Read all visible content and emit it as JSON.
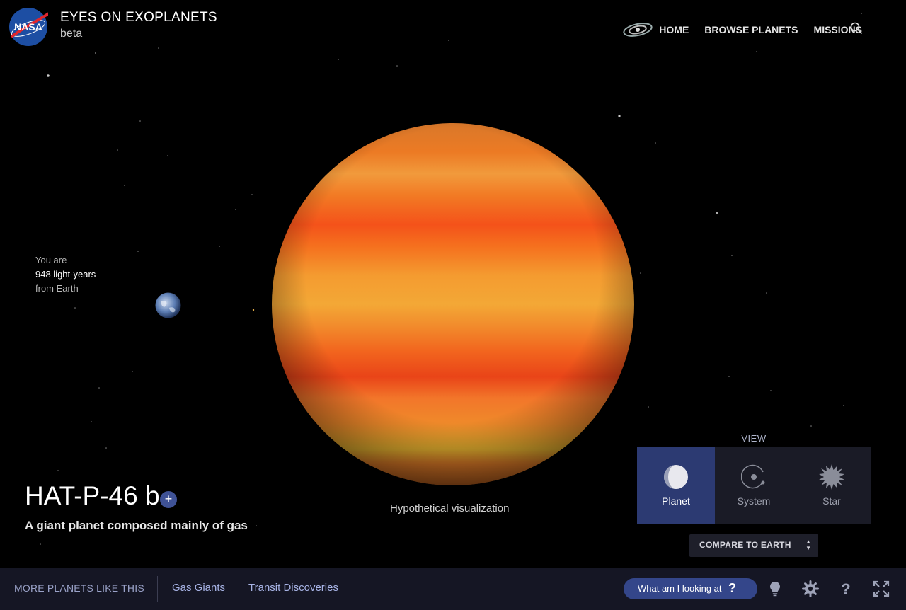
{
  "header": {
    "title": "EYES ON EXOPLANETS",
    "subtitle": "beta",
    "logo": "nasa-logo",
    "nav": [
      {
        "label": "HOME",
        "icon": "galaxy-icon"
      },
      {
        "label": "BROWSE PLANETS"
      },
      {
        "label": "MISSIONS"
      }
    ],
    "search_icon": "search-icon"
  },
  "distance": {
    "line1": "You are",
    "line2": "948 light-years",
    "line3": "from Earth"
  },
  "planet": {
    "name": "HAT-P-46 b",
    "plus_label": "+",
    "description": "A giant planet composed mainly of gas",
    "caption": "Hypothetical visualization"
  },
  "view": {
    "label": "VIEW",
    "options": [
      {
        "label": "Planet",
        "icon": "planet-icon",
        "active": true
      },
      {
        "label": "System",
        "icon": "system-icon",
        "active": false
      },
      {
        "label": "Star",
        "icon": "star-icon",
        "active": false
      }
    ],
    "compare_label": "COMPARE TO EARTH",
    "compare_arrows_up": "▲",
    "compare_arrows_down": "▼"
  },
  "footer": {
    "more_label": "MORE PLANETS LIKE THIS",
    "links": [
      "Gas Giants",
      "Transit Discoveries"
    ],
    "what_label": "What am I looking at",
    "what_q": "?",
    "icons": [
      "lightbulb-icon",
      "settings-icon",
      "help-icon",
      "fullscreen-icon"
    ]
  },
  "colors": {
    "accent": "#34468a",
    "active_view": "#2c3a72",
    "footer_bg": "#151624",
    "planet_orange": "#f07a1e"
  }
}
